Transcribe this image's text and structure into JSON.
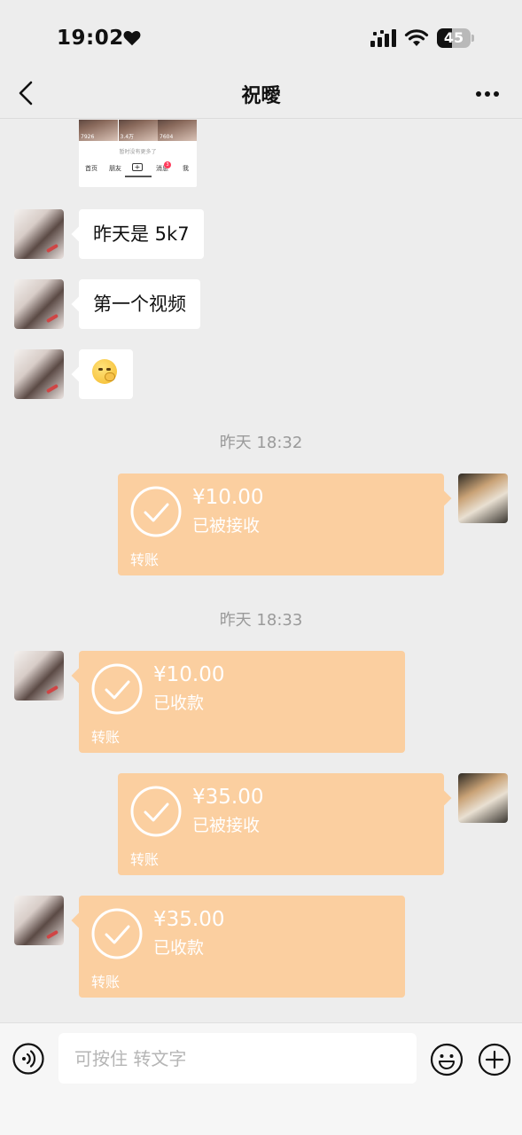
{
  "status_bar": {
    "time": "19:02",
    "battery_level": "45",
    "battery_fraction": 0.45
  },
  "nav": {
    "title": "祝曖"
  },
  "preview": {
    "thumbs": [
      "7926",
      "3.4万",
      "7604"
    ],
    "caption": "暂时没有更多了",
    "tabs": [
      "首页",
      "朋友",
      "消息",
      "我"
    ],
    "badge": "3"
  },
  "messages": [
    {
      "type": "text",
      "text": "昨天是 5k7"
    },
    {
      "type": "text",
      "text": "第一个视频"
    },
    {
      "type": "emoji",
      "icon": "thinking-face-icon"
    }
  ],
  "timestamps": [
    "昨天 18:32",
    "昨天 18:33"
  ],
  "transfers": [
    {
      "amount": "¥10.00",
      "status": "已被接收",
      "label": "转账"
    },
    {
      "amount": "¥10.00",
      "status": "已收款",
      "label": "转账"
    },
    {
      "amount": "¥35.00",
      "status": "已被接收",
      "label": "转账"
    },
    {
      "amount": "¥35.00",
      "status": "已收款",
      "label": "转账"
    }
  ],
  "input": {
    "placeholder": "可按住 转文字"
  },
  "colors": {
    "transfer_bg": "#fbcfa0",
    "chat_bg": "#ededed",
    "badge": "#ff3b5c"
  }
}
